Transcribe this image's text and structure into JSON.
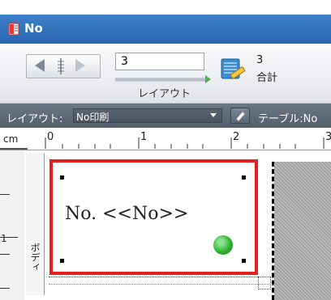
{
  "window": {
    "title": "No"
  },
  "toolbar": {
    "record_value": "3",
    "layout_label": "レイアウト",
    "found_count": "3",
    "total_label": "合計"
  },
  "layout_bar": {
    "layout_label": "レイアウト:",
    "layout_selected": "No印刷",
    "table_label": "テーブル:No"
  },
  "ruler": {
    "unit": "cm",
    "marks": [
      "0",
      "1",
      "2",
      "3"
    ],
    "vertical_mark": "1"
  },
  "part": {
    "label": "ボディ"
  },
  "canvas": {
    "field_text": "No. <<No>>"
  },
  "colors": {
    "title_bar": "#2f6fbd",
    "selection_border": "#e51f1f",
    "layout_bar": "#5f6b78",
    "indicator": "#31b131"
  },
  "icons": [
    "app-icon",
    "book-icon",
    "prev-record-icon",
    "next-record-icon",
    "found-set-icon",
    "edit-icon",
    "dropdown-chevron-icon"
  ]
}
